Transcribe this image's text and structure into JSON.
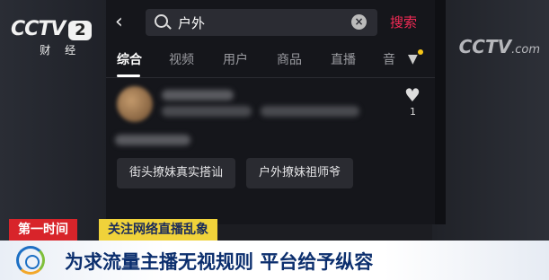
{
  "watermark": {
    "cctv2_brand": "CCTV",
    "cctv2_number": "2",
    "cctv2_channel": "财 经",
    "cctvcom": "CCTV",
    "cctvcom_suffix": ".com"
  },
  "search": {
    "back_icon": "chevron-left-icon",
    "query": "户外",
    "clear_icon": "clear-circle-icon",
    "button_label": "搜索"
  },
  "tabs": [
    "综合",
    "视频",
    "用户",
    "商品",
    "直播",
    "音"
  ],
  "filter_icon": "filter-icon",
  "result": {
    "like_count": "1"
  },
  "history_chips": [
    "街头撩妹真实搭讪",
    "户外撩妹祖师爷"
  ],
  "ticker": {
    "tag": "第一时间",
    "topic": "关注网络直播乱象"
  },
  "headline": "为求流量主播无视规则  平台给予纵容"
}
